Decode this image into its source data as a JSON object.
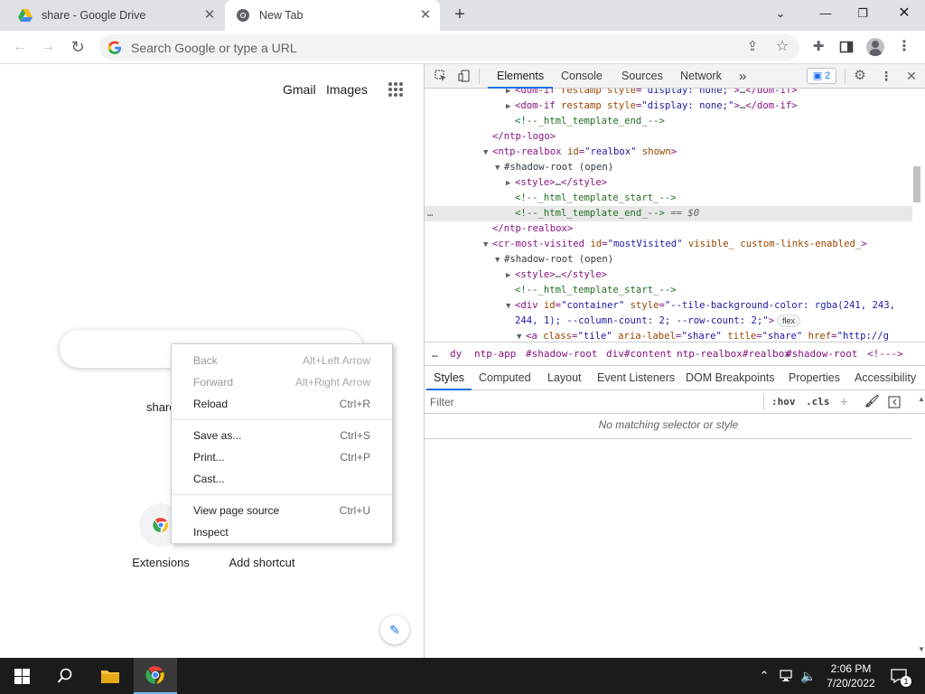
{
  "browser": {
    "tabs": [
      {
        "title": "share - Google Drive",
        "active": false
      },
      {
        "title": "New Tab",
        "active": true
      }
    ],
    "omnibox_placeholder": "Search Google or type a URL"
  },
  "new_tab_page": {
    "gmail": "Gmail",
    "images": "Images",
    "shortcut_partial": "share",
    "shortcuts": [
      {
        "label": "Extensions"
      },
      {
        "label": "Add shortcut"
      }
    ]
  },
  "context_menu": {
    "groups": [
      [
        {
          "label": "Back",
          "shortcut": "Alt+Left Arrow",
          "disabled": true
        },
        {
          "label": "Forward",
          "shortcut": "Alt+Right Arrow",
          "disabled": true
        },
        {
          "label": "Reload",
          "shortcut": "Ctrl+R",
          "disabled": false
        }
      ],
      [
        {
          "label": "Save as...",
          "shortcut": "Ctrl+S",
          "disabled": false
        },
        {
          "label": "Print...",
          "shortcut": "Ctrl+P",
          "disabled": false
        },
        {
          "label": "Cast...",
          "shortcut": "",
          "disabled": false
        }
      ],
      [
        {
          "label": "View page source",
          "shortcut": "Ctrl+U",
          "disabled": false
        },
        {
          "label": "Inspect",
          "shortcut": "",
          "disabled": false
        }
      ]
    ]
  },
  "devtools": {
    "tabs": [
      "Elements",
      "Console",
      "Sources",
      "Network"
    ],
    "more_tabs": "»",
    "issues_count": "2",
    "dom_lines": [
      {
        "text": "▶<dom-if restamp style=\"display: none;\">…</dom-if>"
      },
      {
        "text": "▶<dom-if restamp style=\"display: none;\">…</dom-if>"
      },
      {
        "text": "<!--_html_template_end_-->"
      },
      {
        "text": "</ntp-logo>"
      },
      {
        "text": "▼<ntp-realbox id=\"realbox\" shown>"
      },
      {
        "text": "▼#shadow-root (open)"
      },
      {
        "text": "▶<style>…</style>"
      },
      {
        "text": "<!--_html_template_start_-->"
      },
      {
        "text": "<!--_html_template_end_--> == $0"
      },
      {
        "text": "</ntp-realbox>"
      },
      {
        "text": "▼<cr-most-visited id=\"mostVisited\" visible_ custom-links-enabled_>"
      },
      {
        "text": "▼#shadow-root (open)"
      },
      {
        "text": "▶<style>…</style>"
      },
      {
        "text": "<!--_html_template_start_-->"
      },
      {
        "text": "▼<div id=\"container\" style=\"--tile-background-color: rgba(241, 243,"
      },
      {
        "text": "244, 1); --column-count: 2; --row-count: 2;\">"
      },
      {
        "text": "▼<a class=\"tile\" aria-label=\"share\" title=\"share\" href=\"http://g"
      }
    ],
    "flex_badge": "flex",
    "selected_marker": "== $0",
    "ellipsis": "…",
    "breadcrumbs": [
      "…",
      "dy",
      "ntp-app",
      "#shadow-root",
      "div#content",
      "ntp-realbox#realbox",
      "#shadow-root",
      "<!--->"
    ],
    "subtabs": [
      "Styles",
      "Computed",
      "Layout",
      "Event Listeners",
      "DOM Breakpoints",
      "Properties",
      "Accessibility"
    ],
    "filter_placeholder": "Filter",
    "hov": ":hov",
    "cls": ".cls",
    "no_match": "No matching selector or style"
  },
  "taskbar": {
    "time": "2:06 PM",
    "date": "7/20/2022",
    "notification_count": "1"
  },
  "colors": {
    "accent": "#1a73e8",
    "tabstrip": "#dee1e6",
    "taskbar": "#1b1b1b"
  }
}
